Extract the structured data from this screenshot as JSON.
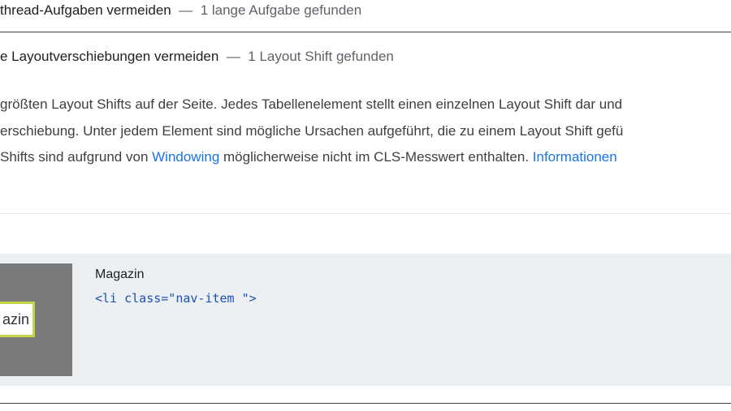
{
  "audits": [
    {
      "title": "thread-Aufgaben vermeiden",
      "separator": "—",
      "display_value": "1 lange Aufgabe gefunden"
    },
    {
      "title": "e Layoutverschiebungen vermeiden",
      "separator": "—",
      "display_value": "1 Layout Shift gefunden"
    }
  ],
  "description": {
    "line1": "größten Layout Shifts auf der Seite. Jedes Tabellenelement stellt einen einzelnen Layout Shift dar und",
    "line2": "erschiebung. Unter jedem Element sind mögliche Ursachen aufgeführt, die zu einem Layout Shift gefü",
    "line3_before": "Shifts sind aufgrund von ",
    "line3_link": "Windowing",
    "line3_middle": " möglicherweise nicht im CLS-Messwert enthalten. ",
    "line3_link2": "Informationen"
  },
  "element": {
    "thumbnail_text": "azin",
    "label": "Magazin",
    "snippet": "<li class=\"nav-item \">"
  },
  "colors": {
    "link": "#1a73e8",
    "panel_bg": "#edf0f3",
    "thumbnail_bg": "#7b7b7b",
    "highlight_border": "#c6d64a",
    "snippet": "#1a4fb4"
  }
}
